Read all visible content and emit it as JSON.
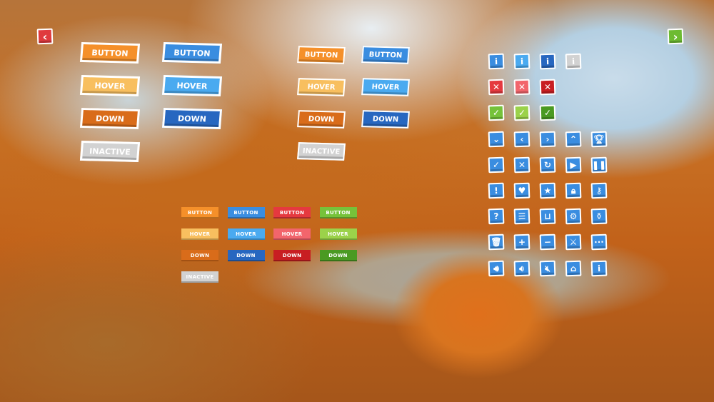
{
  "nav": {
    "back_icon": "chevron-left-icon",
    "forward_icon": "chevron-right-icon",
    "back_color": "#e03a3e",
    "forward_color": "#6dbb32"
  },
  "colors": {
    "orange": "#f5902a",
    "orange_hover": "#f8bf5f",
    "orange_down": "#d96c1a",
    "blue": "#3a8de0",
    "blue_hover": "#4aaaf0",
    "blue_down": "#2767c0",
    "red": "#e5393f",
    "red_hover": "#f2656c",
    "red_down": "#c81e22",
    "green": "#76c23a",
    "green_hover": "#9bd24a",
    "green_down": "#4a9a22",
    "inactive": "#d2d2d2"
  },
  "large_buttons": [
    {
      "label": "BUTTON",
      "color": "#f5902a"
    },
    {
      "label": "BUTTON",
      "color": "#3a8de0"
    },
    {
      "label": "HOVER",
      "color": "#f8bf5f"
    },
    {
      "label": "HOVER",
      "color": "#4aaaf0"
    },
    {
      "label": "DOWN",
      "color": "#d96c1a"
    },
    {
      "label": "DOWN",
      "color": "#2767c0"
    },
    {
      "label": "INACTIVE",
      "color": "#d2d2d2"
    }
  ],
  "medium_buttons": [
    {
      "label": "BUTTON",
      "color": "#f5902a"
    },
    {
      "label": "BUTTON",
      "color": "#3a8de0"
    },
    {
      "label": "HOVER",
      "color": "#f8bf5f"
    },
    {
      "label": "HOVER",
      "color": "#4aaaf0"
    },
    {
      "label": "DOWN",
      "color": "#d96c1a"
    },
    {
      "label": "DOWN",
      "color": "#2767c0"
    },
    {
      "label": "INACTIVE",
      "color": "#d2d2d2"
    }
  ],
  "small_buttons": [
    [
      {
        "label": "BUTTON",
        "color": "#f5902a"
      },
      {
        "label": "BUTTON",
        "color": "#3a8de0"
      },
      {
        "label": "BUTTON",
        "color": "#e5393f"
      },
      {
        "label": "BUTTON",
        "color": "#76c23a"
      }
    ],
    [
      {
        "label": "HOVER",
        "color": "#f8bf5f"
      },
      {
        "label": "HOVER",
        "color": "#4aaaf0"
      },
      {
        "label": "HOVER",
        "color": "#f2656c"
      },
      {
        "label": "HOVER",
        "color": "#9bd24a"
      }
    ],
    [
      {
        "label": "DOWN",
        "color": "#d96c1a"
      },
      {
        "label": "DOWN",
        "color": "#2767c0"
      },
      {
        "label": "DOWN",
        "color": "#c81e22"
      },
      {
        "label": "DOWN",
        "color": "#4a9a22"
      }
    ],
    [
      {
        "label": "INACTIVE",
        "color": "#d2d2d2"
      }
    ]
  ],
  "icon_rows": [
    [
      {
        "icon": "info-icon",
        "color": "#3a8de0"
      },
      {
        "icon": "info-icon",
        "color": "#4aaaf0"
      },
      {
        "icon": "info-icon",
        "color": "#2767c0"
      },
      {
        "icon": "info-icon",
        "color": "#d2d2d2"
      }
    ],
    [
      {
        "icon": "close-icon",
        "color": "#e5393f"
      },
      {
        "icon": "close-icon",
        "color": "#f2656c"
      },
      {
        "icon": "close-icon",
        "color": "#c81e22"
      }
    ],
    [
      {
        "icon": "check-icon",
        "color": "#76c23a"
      },
      {
        "icon": "check-icon",
        "color": "#9bd24a"
      },
      {
        "icon": "check-icon",
        "color": "#4a9a22"
      }
    ],
    [
      {
        "icon": "chevron-down-icon",
        "color": "#3a8de0"
      },
      {
        "icon": "chevron-left-icon",
        "color": "#3a8de0"
      },
      {
        "icon": "chevron-right-icon",
        "color": "#3a8de0"
      },
      {
        "icon": "chevron-up-icon",
        "color": "#3a8de0"
      },
      {
        "icon": "trophy-icon",
        "color": "#3a8de0"
      }
    ],
    [
      {
        "icon": "check-icon",
        "color": "#3a8de0"
      },
      {
        "icon": "close-icon",
        "color": "#3a8de0"
      },
      {
        "icon": "refresh-icon",
        "color": "#3a8de0"
      },
      {
        "icon": "play-icon",
        "color": "#3a8de0"
      },
      {
        "icon": "pause-icon",
        "color": "#3a8de0"
      }
    ],
    [
      {
        "icon": "exclamation-icon",
        "color": "#3a8de0"
      },
      {
        "icon": "heart-icon",
        "color": "#3a8de0"
      },
      {
        "icon": "star-icon",
        "color": "#3a8de0"
      },
      {
        "icon": "lock-icon",
        "color": "#3a8de0"
      },
      {
        "icon": "keyhole-icon",
        "color": "#3a8de0"
      }
    ],
    [
      {
        "icon": "question-icon",
        "color": "#3a8de0"
      },
      {
        "icon": "menu-icon",
        "color": "#3a8de0"
      },
      {
        "icon": "basket-icon",
        "color": "#3a8de0"
      },
      {
        "icon": "gear-icon",
        "color": "#3a8de0"
      },
      {
        "icon": "potion-icon",
        "color": "#3a8de0"
      }
    ],
    [
      {
        "icon": "trash-icon",
        "color": "#3a8de0"
      },
      {
        "icon": "plus-icon",
        "color": "#3a8de0"
      },
      {
        "icon": "minus-icon",
        "color": "#3a8de0"
      },
      {
        "icon": "crossed-swords-icon",
        "color": "#3a8de0"
      },
      {
        "icon": "more-icon",
        "color": "#3a8de0"
      }
    ],
    [
      {
        "icon": "sound-on-icon",
        "color": "#3a8de0"
      },
      {
        "icon": "sound-low-icon",
        "color": "#3a8de0"
      },
      {
        "icon": "sound-mute-icon",
        "color": "#3a8de0"
      },
      {
        "icon": "home-icon",
        "color": "#3a8de0"
      },
      {
        "icon": "info-icon",
        "color": "#3a8de0"
      }
    ]
  ]
}
